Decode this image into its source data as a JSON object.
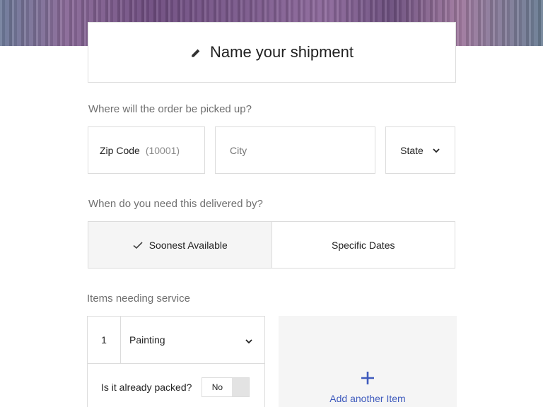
{
  "header": {
    "title": "Name your shipment",
    "pencil_icon": "pencil-icon"
  },
  "pickup": {
    "label": "Where will the order be picked up?",
    "zip_label": "Zip Code",
    "zip_hint": "(10001)",
    "city_placeholder": "City",
    "state_label": "State"
  },
  "delivery": {
    "label": "When do you need this delivered by?",
    "options": [
      {
        "label": "Soonest Available",
        "selected": true
      },
      {
        "label": "Specific Dates",
        "selected": false
      }
    ]
  },
  "items": {
    "label": "Items needing service",
    "list": [
      {
        "number": "1",
        "type": "Painting",
        "packed_question": "Is it already packed?",
        "packed_value": "No"
      }
    ],
    "add_label": "Add another Item"
  },
  "colors": {
    "accent": "#3f5bbd",
    "border": "#dcdcdc",
    "selected_bg": "#f5f5f5"
  }
}
